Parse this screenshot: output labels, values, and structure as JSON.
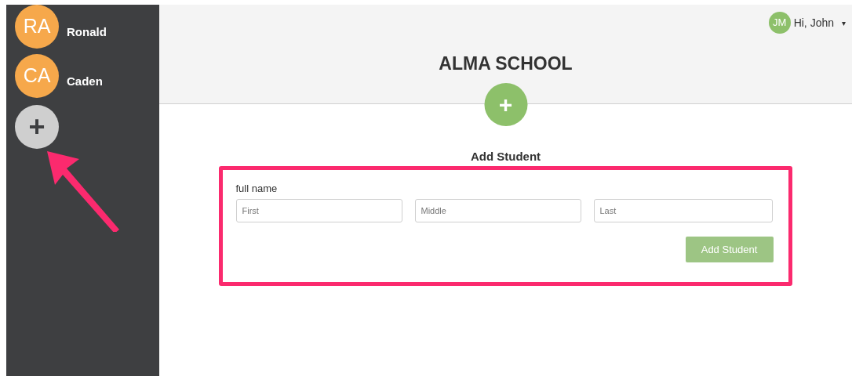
{
  "sidebar": {
    "students": [
      {
        "initials": "RA",
        "name": "Ronald"
      },
      {
        "initials": "CA",
        "name": "Caden"
      }
    ],
    "add_button": {
      "label": "+"
    }
  },
  "header": {
    "user": {
      "initials": "JM",
      "greeting": "Hi, John",
      "caret": "▾"
    },
    "title": "ALMA SCHOOL",
    "add_button": {
      "label": "+"
    }
  },
  "form": {
    "title": "Add Student",
    "label": "full name",
    "fields": [
      {
        "placeholder": "First"
      },
      {
        "placeholder": "Middle"
      },
      {
        "placeholder": "Last"
      }
    ],
    "submit": "Add Student"
  }
}
